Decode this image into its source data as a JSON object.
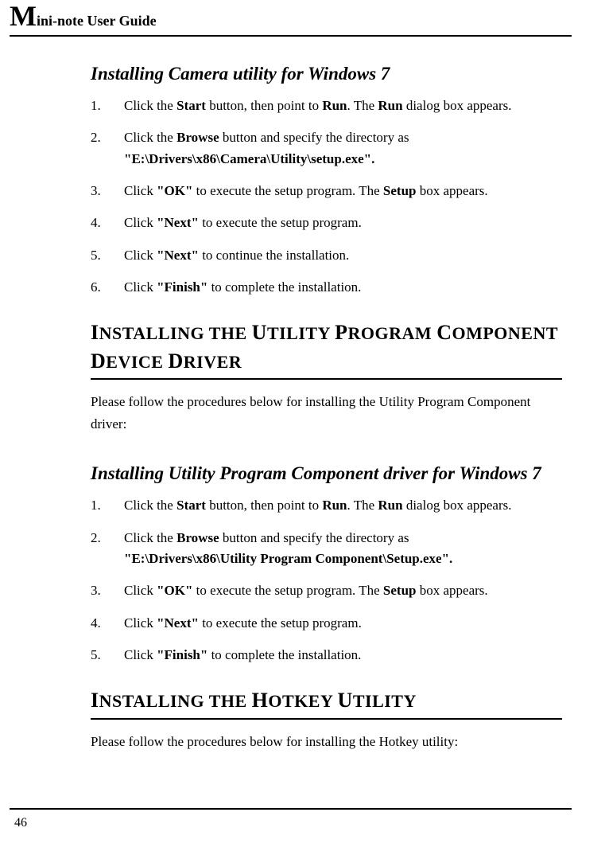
{
  "header": {
    "title_big": "M",
    "title_rest": "ini-note User Guide"
  },
  "sec1": {
    "subheading": "Installing Camera utility for Windows 7",
    "steps": [
      {
        "pre": "Click the ",
        "b1": "Start",
        "mid1": " button, then point to ",
        "b2": "Run",
        "mid2": ". The ",
        "b3": "Run",
        "post": " dialog box appears."
      },
      {
        "pre": "Click the ",
        "b1": "Browse",
        "mid1": " button and specify the directory as ",
        "line2b": "\"E:\\Drivers\\x86\\Camera\\Utility\\setup.exe\"."
      },
      {
        "pre": "Click ",
        "b1": "\"OK\"",
        "mid1": " to execute the setup program. The ",
        "b2": "Setup",
        "post": " box appears."
      },
      {
        "pre": "Click ",
        "b1": "\"Next\"",
        "post": " to execute the setup program."
      },
      {
        "pre": "Click ",
        "b1": "\"Next\"",
        "post": " to continue the installation."
      },
      {
        "pre": "Click ",
        "b1": "\"Finish\"",
        "post": " to complete the installation."
      }
    ]
  },
  "sec2": {
    "heading": {
      "w1b": "I",
      "w1": "NSTALLING THE ",
      "w2b": "U",
      "w2": "TILITY ",
      "w3b": "P",
      "w3": "ROGRAM ",
      "w4b": "C",
      "w4": "OMPONENT ",
      "w5b": "D",
      "w5": "EVICE ",
      "w6b": "D",
      "w6": "RIVER"
    },
    "intro": "Please follow the procedures below for installing the Utility Program Component driver:",
    "subheading": "Installing Utility Program Component driver for Windows 7",
    "steps": [
      {
        "pre": "Click the ",
        "b1": "Start",
        "mid1": " button, then point to ",
        "b2": "Run",
        "mid2": ". The ",
        "b3": "Run",
        "post": " dialog box appears."
      },
      {
        "pre": "Click the ",
        "b1": "Browse",
        "mid1": " button and specify the directory as ",
        "line2b": "\"E:\\Drivers\\x86\\Utility Program Component\\Setup.exe\"."
      },
      {
        "pre": "Click ",
        "b1": "\"OK\"",
        "mid1": " to execute the setup program. The ",
        "b2": "Setup",
        "post": " box appears."
      },
      {
        "pre": "Click ",
        "b1": "\"Next\"",
        "post": " to execute the setup program."
      },
      {
        "pre": "Click ",
        "b1": "\"Finish\"",
        "post": " to complete the installation."
      }
    ]
  },
  "sec3": {
    "heading": {
      "w1b": "I",
      "w1": "NSTALLING THE ",
      "w2b": "H",
      "w2": "OTKEY ",
      "w3b": "U",
      "w3": "TILITY"
    },
    "intro": "Please follow the procedures below for installing the Hotkey utility:"
  },
  "page_number": "46"
}
